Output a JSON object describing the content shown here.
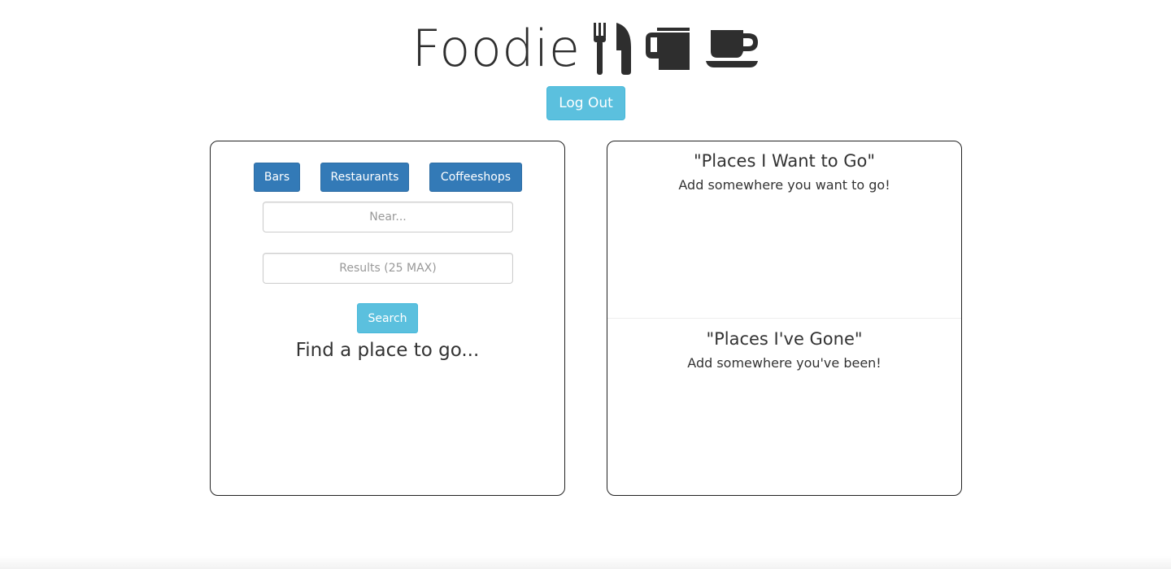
{
  "header": {
    "title": "Foodie",
    "icons": [
      "fork-knife-icon",
      "mug-icon",
      "coffee-cup-icon"
    ]
  },
  "auth": {
    "logout_label": "Log Out"
  },
  "search_panel": {
    "categories": [
      "Bars",
      "Restaurants",
      "Coffeeshops"
    ],
    "near_placeholder": "Near...",
    "results_placeholder": "Results (25 MAX)",
    "search_label": "Search",
    "prompt": "Find a place to go..."
  },
  "lists_panel": {
    "want": {
      "title": "\"Places I Want to Go\"",
      "empty_text": "Add somewhere you want to go!"
    },
    "gone": {
      "title": "\"Places I've Gone\"",
      "empty_text": "Add somewhere you've been!"
    }
  },
  "colors": {
    "primary": "#337ab7",
    "info": "#5bc0de",
    "text": "#333333"
  }
}
